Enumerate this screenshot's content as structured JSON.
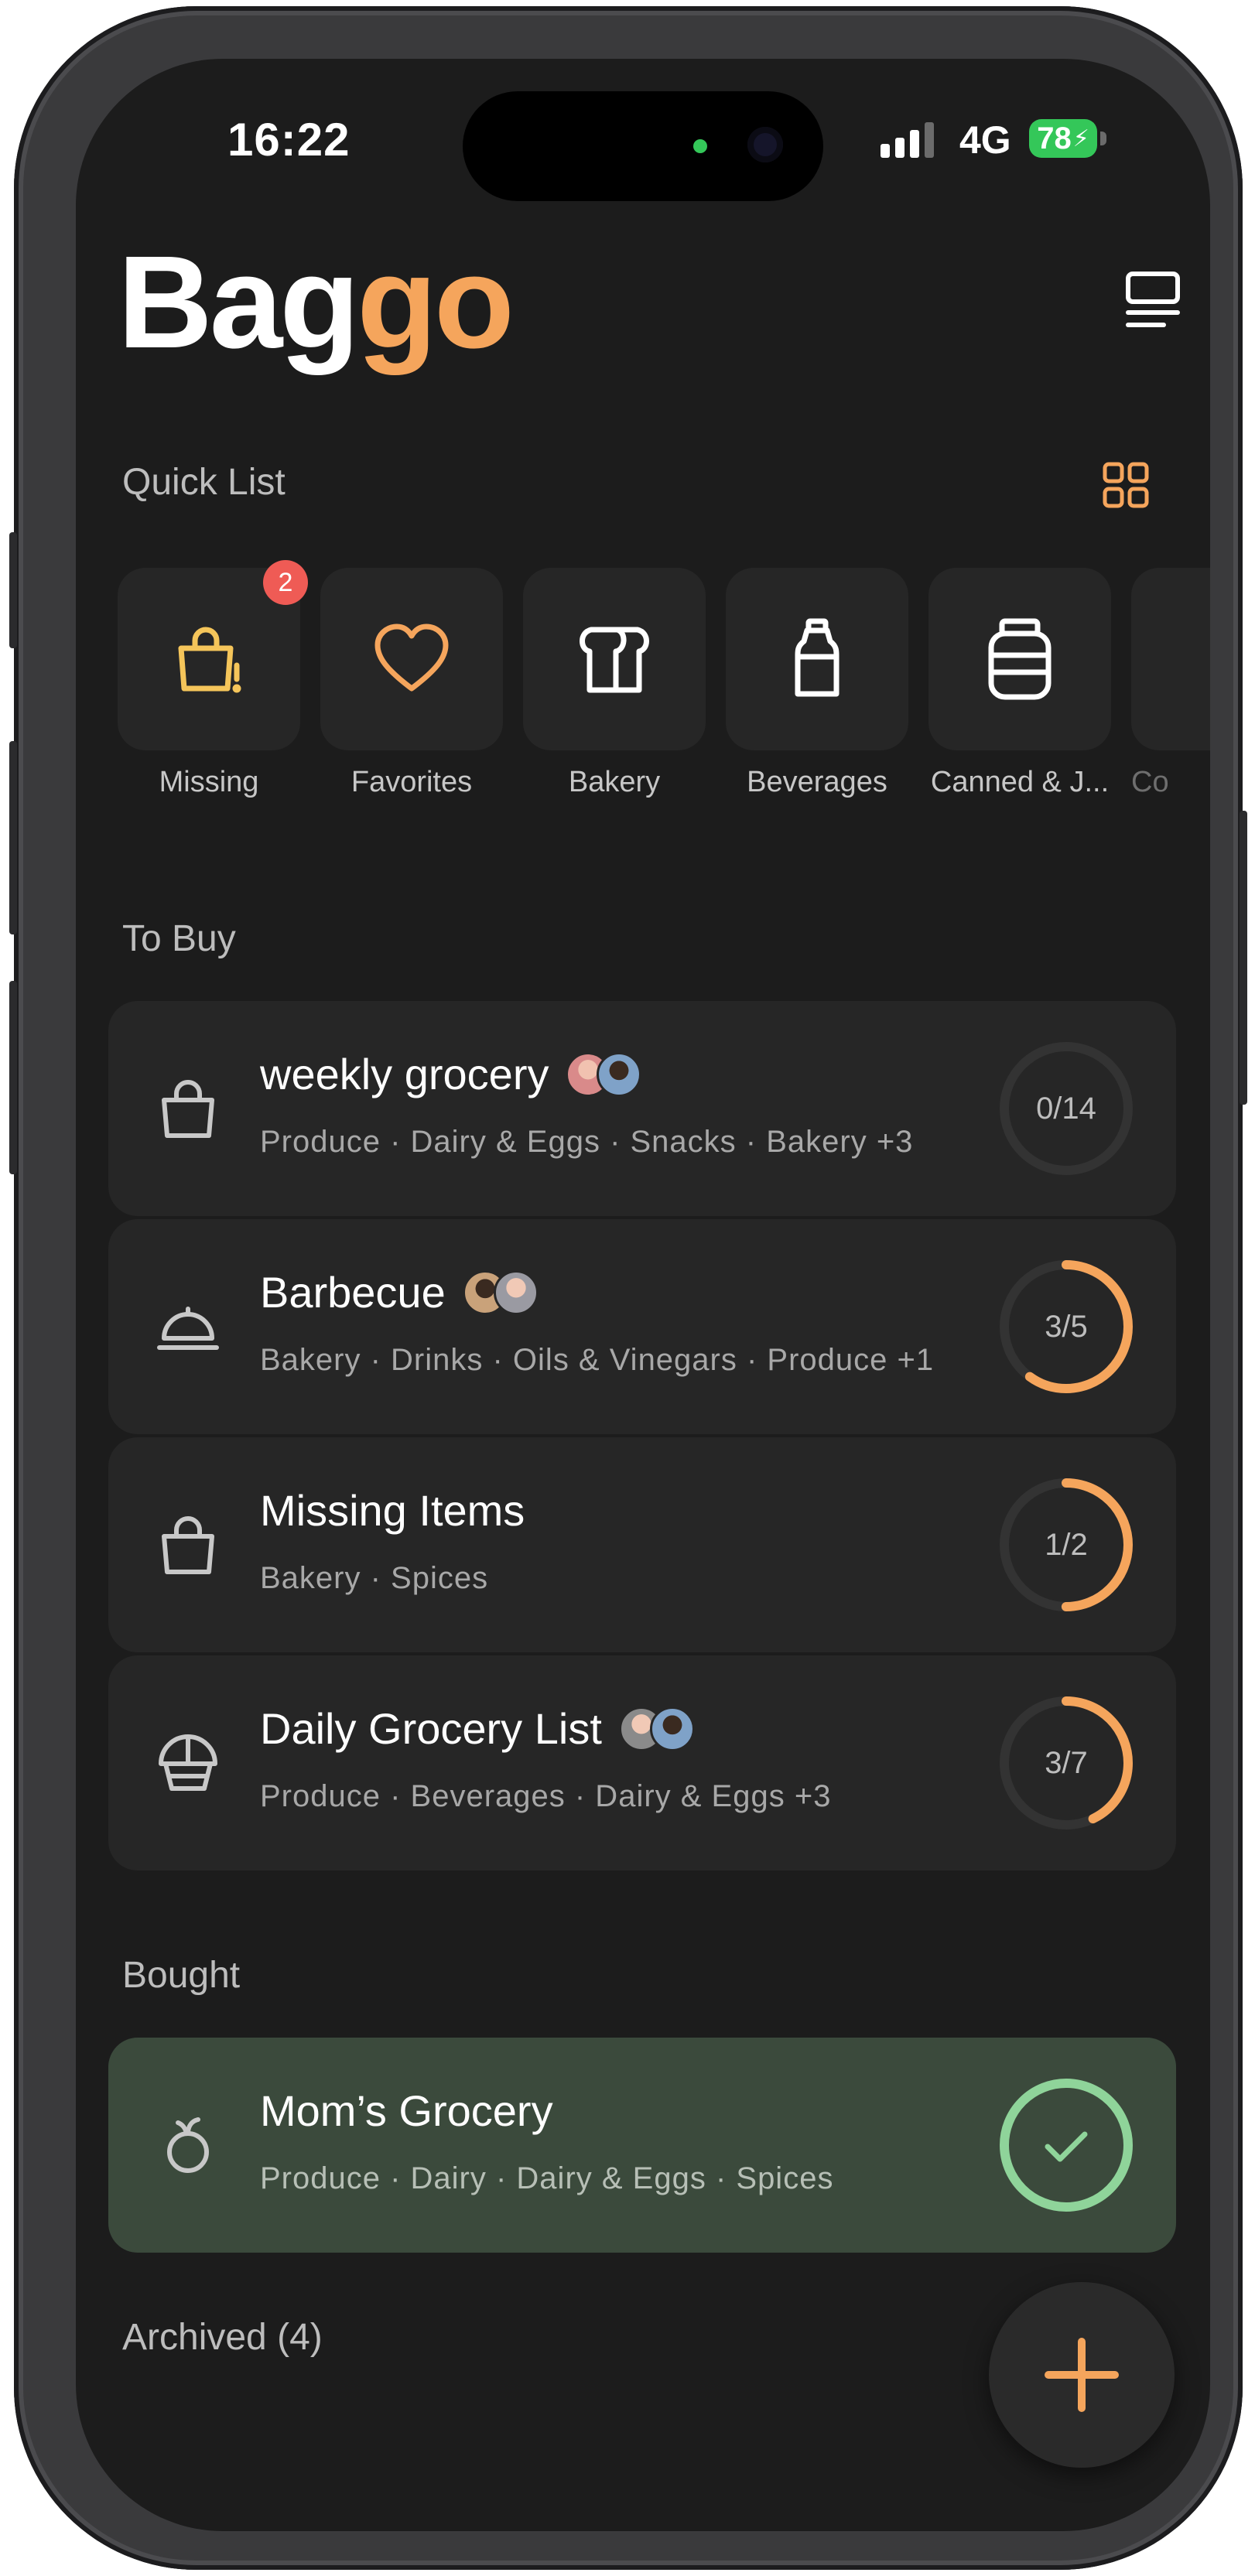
{
  "status_bar": {
    "time": "16:22",
    "network": "4G",
    "battery": "78"
  },
  "app": {
    "brand_part1": "Bag",
    "brand_part2": "go"
  },
  "quick_list": {
    "title": "Quick List",
    "items": [
      {
        "label": "Missing",
        "icon": "bag-alert-icon",
        "badge": "2"
      },
      {
        "label": "Favorites",
        "icon": "heart-icon"
      },
      {
        "label": "Bakery",
        "icon": "bread-icon"
      },
      {
        "label": "Beverages",
        "icon": "bottle-icon"
      },
      {
        "label": "Canned & J...",
        "icon": "jar-icon"
      },
      {
        "label": "Co",
        "icon": "category-icon"
      }
    ]
  },
  "to_buy": {
    "title": "To Buy",
    "lists": [
      {
        "title": "weekly grocery",
        "categories": "Produce · Dairy & Eggs · Snacks · Bakery +3",
        "progress": "0/14",
        "done": 0,
        "total": 14,
        "icon": "shopping-bag-icon"
      },
      {
        "title": "Barbecue",
        "categories": "Bakery · Drinks · Oils & Vinegars · Produce +1",
        "progress": "3/5",
        "done": 3,
        "total": 5,
        "icon": "cloche-icon"
      },
      {
        "title": "Missing Items",
        "categories": "Bakery · Spices",
        "progress": "1/2",
        "done": 1,
        "total": 2,
        "icon": "shopping-bag-icon"
      },
      {
        "title": "Daily Grocery List",
        "categories": "Produce · Beverages · Dairy & Eggs +3",
        "progress": "3/7",
        "done": 3,
        "total": 7,
        "icon": "grocery-basket-icon"
      }
    ]
  },
  "bought": {
    "title": "Bought",
    "lists": [
      {
        "title": "Mom’s Grocery",
        "categories": "Produce · Dairy · Dairy & Eggs · Spices",
        "icon": "apple-icon"
      }
    ]
  },
  "archived": {
    "title": "Archived (4)"
  },
  "colors": {
    "accent": "#f5a55c",
    "bought_bg": "#3b4a3c",
    "check": "#8fd49a",
    "badge": "#ef5b55"
  }
}
